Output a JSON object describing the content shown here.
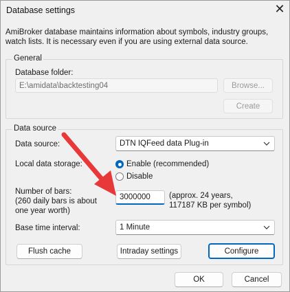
{
  "window": {
    "title": "Database settings",
    "description": "AmiBroker database maintains information about symbols, industry groups, watch lists. It is necessary even if you are using external data source."
  },
  "general": {
    "legend": "General",
    "folder_label": "Database folder:",
    "folder_value": "E:\\amidata\\backtesting04",
    "browse_label": "Browse...",
    "create_label": "Create"
  },
  "data_source": {
    "legend": "Data source",
    "source_label": "Data source:",
    "source_value": "DTN IQFeed data Plug-in",
    "local_storage_label": "Local data storage:",
    "enable_label": "Enable (recommended)",
    "disable_label": "Disable",
    "enable_selected": true,
    "bars_label_line1": "Number of bars:",
    "bars_label_line2": "(260 daily bars is about one year worth)",
    "bars_value": "3000000",
    "bars_note": "(approx. 24 years, 117187 KB per symbol)",
    "interval_label": "Base time interval:",
    "interval_value": "1 Minute",
    "flush_label": "Flush cache",
    "intraday_label": "Intraday settings",
    "configure_label": "Configure"
  },
  "footer": {
    "ok_label": "OK",
    "cancel_label": "Cancel"
  },
  "colors": {
    "accent": "#0067c0",
    "annotation_arrow": "#e8393a"
  },
  "icons": [
    "close-icon",
    "chevron-down-icon",
    "annotation-arrow"
  ]
}
